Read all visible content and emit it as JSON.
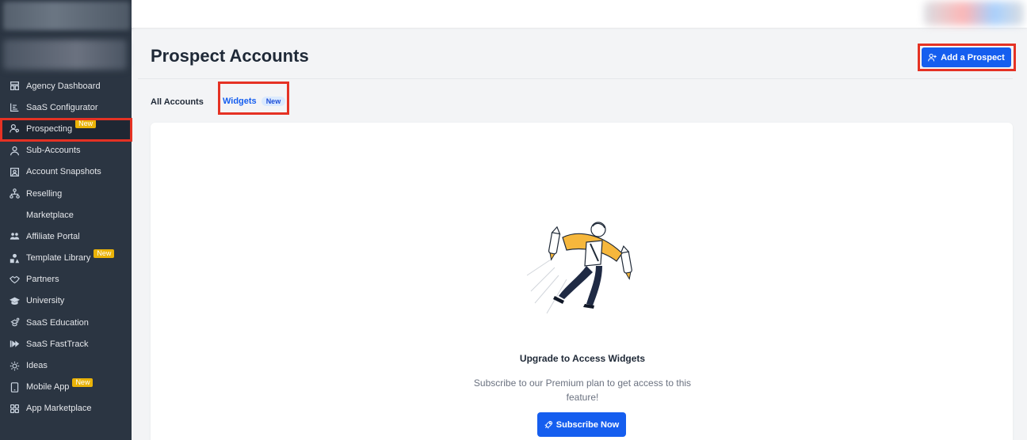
{
  "sidebar": {
    "items": [
      {
        "label": "Agency Dashboard",
        "icon": "dashboard-icon",
        "badge": ""
      },
      {
        "label": "SaaS Configurator",
        "icon": "chart-icon",
        "badge": ""
      },
      {
        "label": "Prospecting",
        "icon": "users-icon",
        "badge": "New"
      },
      {
        "label": "Sub-Accounts",
        "icon": "user-icon",
        "badge": ""
      },
      {
        "label": "Account Snapshots",
        "icon": "snapshot-icon",
        "badge": ""
      },
      {
        "label": "Reselling",
        "icon": "hierarchy-icon",
        "badge": ""
      },
      {
        "label": "Marketplace",
        "icon": "",
        "badge": ""
      },
      {
        "label": "Affiliate Portal",
        "icon": "group-icon",
        "badge": ""
      },
      {
        "label": "Template Library",
        "icon": "shapes-icon",
        "badge": "New"
      },
      {
        "label": "Partners",
        "icon": "handshake-icon",
        "badge": ""
      },
      {
        "label": "University",
        "icon": "graduation-cap-icon",
        "badge": ""
      },
      {
        "label": "SaaS Education",
        "icon": "education-icon",
        "badge": ""
      },
      {
        "label": "SaaS FastTrack",
        "icon": "fast-forward-icon",
        "badge": ""
      },
      {
        "label": "Ideas",
        "icon": "lightbulb-icon",
        "badge": ""
      },
      {
        "label": "Mobile App",
        "icon": "mobile-icon",
        "badge": "New"
      },
      {
        "label": "App Marketplace",
        "icon": "grid-icon",
        "badge": ""
      }
    ]
  },
  "header": {
    "title": "Prospect Accounts",
    "add_button": "Add a Prospect"
  },
  "tabs": {
    "all": "All Accounts",
    "widgets": "Widgets",
    "widgets_badge": "New"
  },
  "empty_state": {
    "title": "Upgrade to Access Widgets",
    "description": "Subscribe to our Premium plan to get access to this feature!",
    "button": "Subscribe Now"
  },
  "colors": {
    "sidebar_bg": "#2b3542",
    "primary": "#155eef",
    "highlight": "#e53224",
    "badge": "#eab308"
  }
}
